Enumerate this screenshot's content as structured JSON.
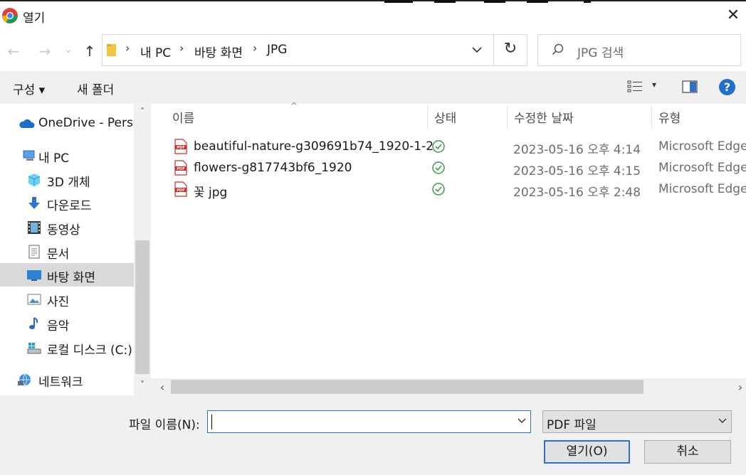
{
  "window": {
    "title": "열기",
    "close_glyph": "✕"
  },
  "nav": {
    "back_glyph": "←",
    "forward_glyph": "→",
    "recent_glyph": "⌄",
    "up_glyph": "↑",
    "breadcrumb": [
      "내 PC",
      "바탕 화면",
      "JPG"
    ],
    "separator": "›",
    "refresh_glyph": "↻",
    "search_placeholder": "JPG 검색"
  },
  "toolbar": {
    "organize_label": "구성 ▾",
    "new_folder_label": "새 폴더",
    "view_dd_glyph": "▾",
    "help_glyph": "?"
  },
  "sidebar": {
    "scroll_up_glyph": "˄",
    "scroll_down_glyph": "˅",
    "items": [
      {
        "label": "OneDrive - Personal",
        "icon": "cloud-icon"
      },
      {
        "label": "내 PC",
        "icon": "pc-icon"
      },
      {
        "label": "3D 개체",
        "icon": "cube-icon"
      },
      {
        "label": "다운로드",
        "icon": "download-icon"
      },
      {
        "label": "동영상",
        "icon": "video-icon"
      },
      {
        "label": "문서",
        "icon": "document-icon"
      },
      {
        "label": "바탕 화면",
        "icon": "desktop-icon",
        "selected": true
      },
      {
        "label": "사진",
        "icon": "pictures-icon"
      },
      {
        "label": "음악",
        "icon": "music-icon"
      },
      {
        "label": "로컬 디스크 (C:)",
        "icon": "disk-icon"
      },
      {
        "label": "네트워크",
        "icon": "network-icon"
      }
    ]
  },
  "files": {
    "sort_glyph": "^",
    "columns": [
      "이름",
      "상태",
      "수정한 날짜",
      "유형"
    ],
    "rows": [
      {
        "name": "beautiful-nature-g309691b74_1920-1-2",
        "date": "2023-05-16 오후 4:14",
        "type": "Microsoft Edge PDF"
      },
      {
        "name": "flowers-g817743bf6_1920",
        "date": "2023-05-16 오후 4:15",
        "type": "Microsoft Edge PDF"
      },
      {
        "name": "꽃 jpg",
        "date": "2023-05-16 오후 2:48",
        "type": "Microsoft Edge PDF"
      }
    ],
    "hscroll_left_glyph": "‹",
    "hscroll_right_glyph": "›"
  },
  "footer": {
    "filename_label": "파일 이름(N):",
    "filename_value": "",
    "filetype_value": "PDF 파일",
    "open_label": "열기(O)",
    "cancel_label": "취소"
  },
  "colors": {
    "accent": "#2f6fc6",
    "status_ok": "#3c9a4b",
    "pdf_red": "#c7312a",
    "selected_bg": "#d9d9d9"
  }
}
